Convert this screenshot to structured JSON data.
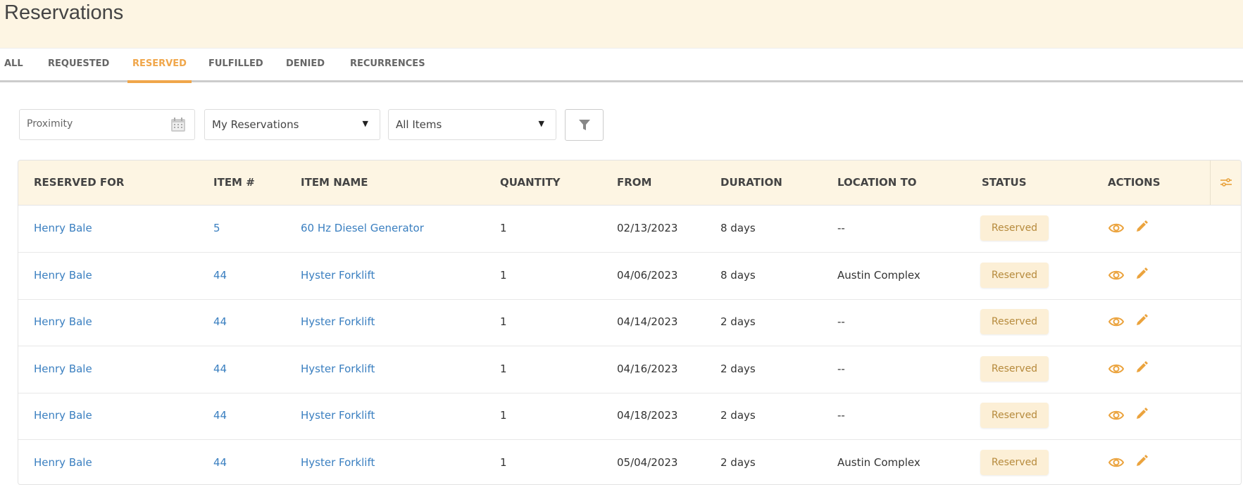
{
  "header": {
    "title": "Reservations"
  },
  "tabs": [
    {
      "label": "ALL"
    },
    {
      "label": "REQUESTED"
    },
    {
      "label": "RESERVED",
      "active": true
    },
    {
      "label": "FULFILLED"
    },
    {
      "label": "DENIED"
    },
    {
      "label": "RECURRENCES"
    }
  ],
  "filters": {
    "proximity_placeholder": "Proximity",
    "reservations_select": "My Reservations",
    "items_select": "All Items"
  },
  "table": {
    "columns": [
      "RESERVED FOR",
      "ITEM #",
      "ITEM NAME",
      "QUANTITY",
      "FROM",
      "DURATION",
      "LOCATION TO",
      "STATUS",
      "ACTIONS"
    ],
    "rows": [
      {
        "reserved_for": "Henry Bale",
        "item_no": "5",
        "item_name": "60 Hz Diesel Generator",
        "quantity": "1",
        "from": "02/13/2023",
        "duration": "8 days",
        "location_to": "--",
        "status": "Reserved"
      },
      {
        "reserved_for": "Henry Bale",
        "item_no": "44",
        "item_name": "Hyster Forklift",
        "quantity": "1",
        "from": "04/06/2023",
        "duration": "8 days",
        "location_to": "Austin Complex",
        "status": "Reserved"
      },
      {
        "reserved_for": "Henry Bale",
        "item_no": "44",
        "item_name": "Hyster Forklift",
        "quantity": "1",
        "from": "04/14/2023",
        "duration": "2 days",
        "location_to": "--",
        "status": "Reserved"
      },
      {
        "reserved_for": "Henry Bale",
        "item_no": "44",
        "item_name": "Hyster Forklift",
        "quantity": "1",
        "from": "04/16/2023",
        "duration": "2 days",
        "location_to": "--",
        "status": "Reserved"
      },
      {
        "reserved_for": "Henry Bale",
        "item_no": "44",
        "item_name": "Hyster Forklift",
        "quantity": "1",
        "from": "04/18/2023",
        "duration": "2 days",
        "location_to": "--",
        "status": "Reserved"
      },
      {
        "reserved_for": "Henry Bale",
        "item_no": "44",
        "item_name": "Hyster Forklift",
        "quantity": "1",
        "from": "05/04/2023",
        "duration": "2 days",
        "location_to": "Austin Complex",
        "status": "Reserved"
      }
    ]
  },
  "colors": {
    "accent": "#f0a64a",
    "link": "#3a7fc0",
    "header_bg": "#fdf5e3",
    "badge_bg": "#fcefd6"
  }
}
